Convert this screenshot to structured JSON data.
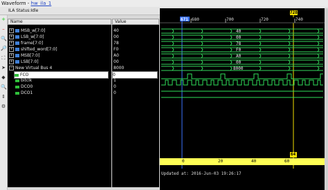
{
  "window": {
    "title": "Waveform - ",
    "link": "hw_ila_1"
  },
  "status": {
    "text": "ILA Status:Idle"
  },
  "toolbar": {
    "icons": [
      "zoom-in-icon",
      "zoom-out-icon",
      "zoom-fit-icon",
      "find-icon",
      "add-icon",
      "remove-icon",
      "cursor-icon",
      "marker-icon",
      "scroll-icon",
      "settings-icon"
    ]
  },
  "columns": {
    "name": "Name",
    "value": "Value"
  },
  "signals": [
    {
      "name": "MSB_w[7:0]",
      "value": "40",
      "kind": "bus",
      "expanded": false
    },
    {
      "name": "LSB_w[7:0]",
      "value": "00",
      "kind": "bus",
      "expanded": false
    },
    {
      "name": "frame[7:0]",
      "value": "78",
      "kind": "bus",
      "expanded": false
    },
    {
      "name": "shifted_word[7:0]",
      "value": "F0",
      "kind": "bus",
      "expanded": false
    },
    {
      "name": "MSB[7:0]",
      "value": "A0",
      "kind": "bus",
      "expanded": false
    },
    {
      "name": "LSB[7:0]",
      "value": "00",
      "kind": "bus",
      "expanded": false
    },
    {
      "name": "New Virtual Bus 4",
      "value": "8000",
      "kind": "vbus",
      "expanded": true
    },
    {
      "name": "FCO",
      "value": "0",
      "kind": "sig",
      "selected": true
    },
    {
      "name": "bitclk",
      "value": "1",
      "kind": "sig"
    },
    {
      "name": "DCO0",
      "value": "0",
      "kind": "sig"
    },
    {
      "name": "DCO1",
      "value": "0",
      "kind": "sig"
    }
  ],
  "wave": {
    "cursor_label": "671",
    "marker_label": "728",
    "ruler_top": [
      "680",
      "700",
      "720",
      "740"
    ],
    "ruler_bottom": [
      "0",
      "20",
      "40",
      "60"
    ],
    "bottom_badge": "64",
    "bus_values": [
      "40",
      "00",
      "78",
      "F0",
      "A0",
      "00",
      "8000"
    ],
    "updated": "Updated at: 2016-Jun-03 19:26:17"
  },
  "colors": {
    "wave_green": "#2fe05a",
    "bus_green": "#35d75c",
    "cursor_blue": "#3c73ff",
    "marker_yellow": "#f5e100"
  }
}
